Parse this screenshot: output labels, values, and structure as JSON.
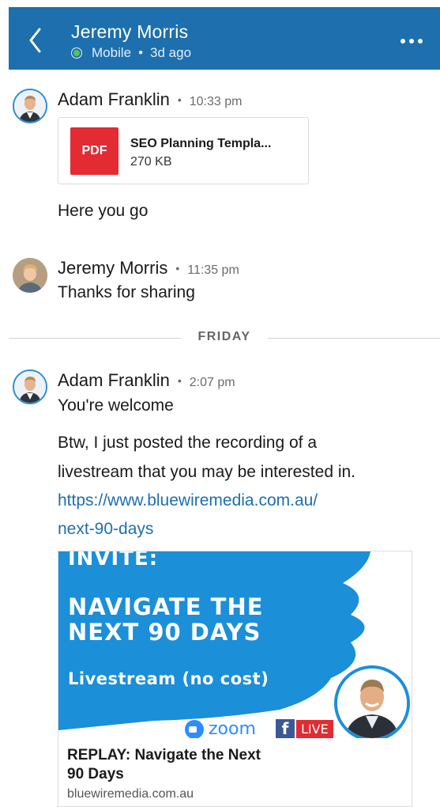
{
  "header": {
    "contact_name": "Jeremy Morris",
    "presence": "Mobile",
    "separator": "•",
    "last_seen": "3d ago",
    "back_icon": "chevron-left-icon",
    "more_icon": "more-horizontal-icon"
  },
  "messages": [
    {
      "sender": "Adam Franklin",
      "dot": "•",
      "time": "10:33 pm",
      "attachment": {
        "type_label": "PDF",
        "name": "SEO Planning Templa...",
        "size": "270 KB"
      },
      "text": "Here you go"
    },
    {
      "sender": "Jeremy Morris",
      "dot": "•",
      "time": "11:35 pm",
      "text": "Thanks for sharing"
    }
  ],
  "day_divider": "FRIDAY",
  "friday_message": {
    "sender": "Adam Franklin",
    "dot": "•",
    "time": "2:07 pm",
    "line1": "You're welcome",
    "line2": "Btw, I just posted the recording of a",
    "line3": "livestream that you may be interested in.",
    "link_line1": "https://www.bluewiremedia.com.au/",
    "link_line2": "next-90-days"
  },
  "link_preview": {
    "banner_invite": "INVITE:",
    "banner_title_1": "NAVIGATE THE",
    "banner_title_2": "NEXT 90 DAYS",
    "banner_subtitle": "Livestream (no cost)",
    "zoom_label": "zoom",
    "fb_letter": "f",
    "live_label": "LIVE",
    "title_line1": "REPLAY: Navigate the Next",
    "title_line2": "90 Days",
    "domain": "bluewiremedia.com.au"
  },
  "colors": {
    "header_bg": "#1d6fae",
    "link": "#1d6fae",
    "pdf_red": "#e22b32",
    "banner_blue": "#1b8fd8",
    "online_green": "#57c15f"
  }
}
